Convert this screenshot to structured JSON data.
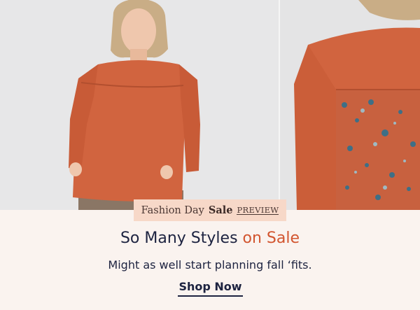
{
  "banner": {
    "badge": {
      "prefix": "Fashion Day",
      "emphasis": "Sale",
      "tag": "PREVIEW"
    },
    "headline": {
      "text": "So Many Styles",
      "accent": "on Sale"
    },
    "subhead": "Might as well start planning fall ‘fits.",
    "cta_label": "Shop Now"
  },
  "colors": {
    "background": "#faf3ef",
    "badge_background": "#f7d8c8",
    "navy_text": "#1d2340",
    "accent_orange": "#d2552f",
    "top_color": "#d1643f"
  }
}
